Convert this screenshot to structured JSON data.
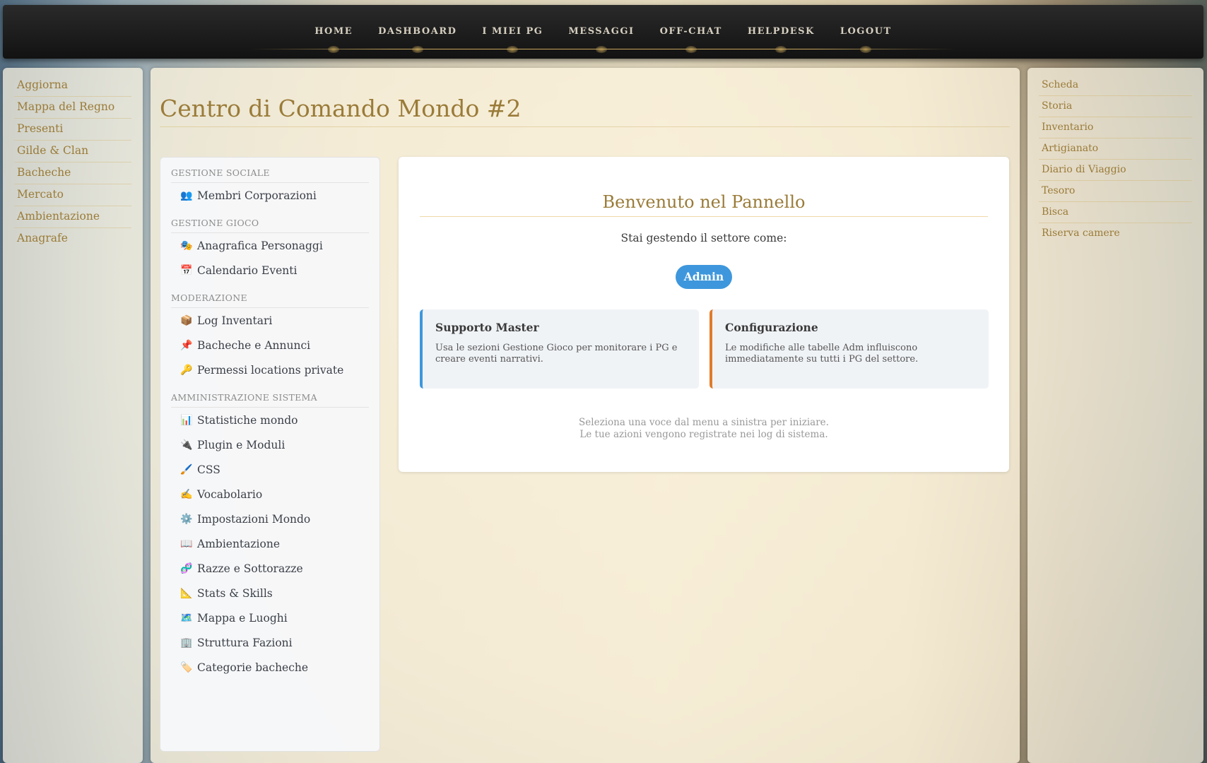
{
  "topnav": {
    "items": [
      "HOME",
      "DASHBOARD",
      "I MIEI PG",
      "MESSAGGI",
      "OFF-CHAT",
      "HELPDESK",
      "LOGOUT"
    ]
  },
  "left_nav": {
    "items": [
      "Aggiorna",
      "Mappa del Regno",
      "Presenti",
      "Gilde & Clan",
      "Bacheche",
      "Mercato",
      "Ambientazione",
      "Anagrafe"
    ]
  },
  "right_nav": {
    "items": [
      "Scheda",
      "Storia",
      "Inventario",
      "Artigianato",
      "Diario di Viaggio",
      "Tesoro",
      "Bisca",
      "Riserva camere"
    ]
  },
  "page": {
    "title": "Centro di Comando Mondo #2"
  },
  "admin_menu": {
    "sections": [
      {
        "title": "GESTIONE SOCIALE",
        "items": [
          {
            "icon": "👥",
            "label": "Membri Corporazioni"
          }
        ]
      },
      {
        "title": "GESTIONE GIOCO",
        "items": [
          {
            "icon": "🎭",
            "label": "Anagrafica Personaggi"
          },
          {
            "icon": "📅",
            "label": "Calendario Eventi"
          }
        ]
      },
      {
        "title": "MODERAZIONE",
        "items": [
          {
            "icon": "📦",
            "label": "Log Inventari"
          },
          {
            "icon": "📌",
            "label": "Bacheche e Annunci"
          },
          {
            "icon": "🔑",
            "label": "Permessi locations private"
          }
        ]
      },
      {
        "title": "AMMINISTRAZIONE SISTEMA",
        "items": [
          {
            "icon": "📊",
            "label": "Statistiche mondo"
          },
          {
            "icon": "🔌",
            "label": "Plugin e Moduli"
          },
          {
            "icon": "🖌️",
            "label": "CSS"
          },
          {
            "icon": "✍️",
            "label": "Vocabolario"
          },
          {
            "icon": "⚙️",
            "label": "Impostazioni Mondo"
          },
          {
            "icon": "📖",
            "label": "Ambientazione"
          },
          {
            "icon": "🧬",
            "label": "Razze e Sottorazze"
          },
          {
            "icon": "📐",
            "label": "Stats & Skills"
          },
          {
            "icon": "🗺️",
            "label": "Mappa e Luoghi"
          },
          {
            "icon": "🏢",
            "label": "Struttura Fazioni"
          },
          {
            "icon": "🏷️",
            "label": "Categorie bacheche"
          }
        ]
      }
    ]
  },
  "welcome": {
    "title": "Benvenuto nel Pannello",
    "subtitle": "Stai gestendo il settore come:",
    "role": "Admin",
    "cards": [
      {
        "title": "Supporto Master",
        "text": "Usa le sezioni Gestione Gioco per monitorare i PG e creare eventi narrativi.",
        "accent": "#3e97dc"
      },
      {
        "title": "Configurazione",
        "text": "Le modifiche alle tabelle Adm influiscono immediatamente su tutti i PG del settore.",
        "accent": "#e07b2b"
      }
    ],
    "footnote_1": "Seleziona una voce dal menu a sinistra per iniziare.",
    "footnote_2": "Le tue azioni vengono registrate nei log di sistema."
  }
}
